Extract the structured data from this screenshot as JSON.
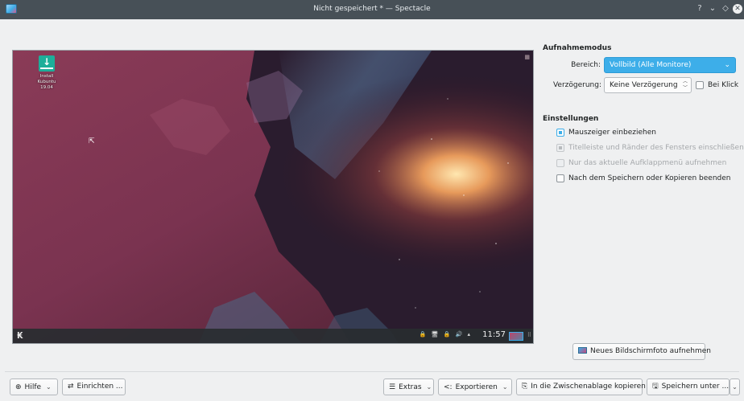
{
  "window": {
    "title": "Nicht gespeichert * — Spectacle",
    "controls": {
      "help": "?",
      "minimize": "⌄",
      "maximize": "◇",
      "close": "✕"
    }
  },
  "preview": {
    "desktop_icon_label": "Install Kubuntu 19.04",
    "panel_clock": "11:57",
    "panel_tray_icons": "🔒 🖥 🔒 🔊 ▴"
  },
  "capture_mode": {
    "heading": "Aufnahmemodus",
    "area_label": "Bereich:",
    "area_value": "Vollbild (Alle Monitore)",
    "delay_label": "Verzögerung:",
    "delay_value": "Keine Verzögerung",
    "on_click_label": "Bei Klick",
    "on_click_checked": false
  },
  "settings": {
    "heading": "Einstellungen",
    "options": [
      {
        "label": "Mauszeiger einbeziehen",
        "checked": true,
        "enabled": true
      },
      {
        "label": "Titelleiste und Ränder des Fensters einschließen",
        "checked": true,
        "enabled": false
      },
      {
        "label": "Nur das aktuelle Aufklappmenü aufnehmen",
        "checked": false,
        "enabled": false
      },
      {
        "label": "Nach dem Speichern oder Kopieren beenden",
        "checked": false,
        "enabled": true
      }
    ]
  },
  "new_screenshot_label": "Neues Bildschirmfoto aufnehmen",
  "toolbar": {
    "help": "Hilfe",
    "configure": "Einrichten ...",
    "extras": "Extras",
    "export": "Exportieren",
    "copy": "In die Zwischenablage kopieren",
    "save_as": "Speichern unter ..."
  },
  "colors": {
    "accent": "#3daee9",
    "titlebar": "#475057",
    "window_bg": "#eff0f1"
  }
}
